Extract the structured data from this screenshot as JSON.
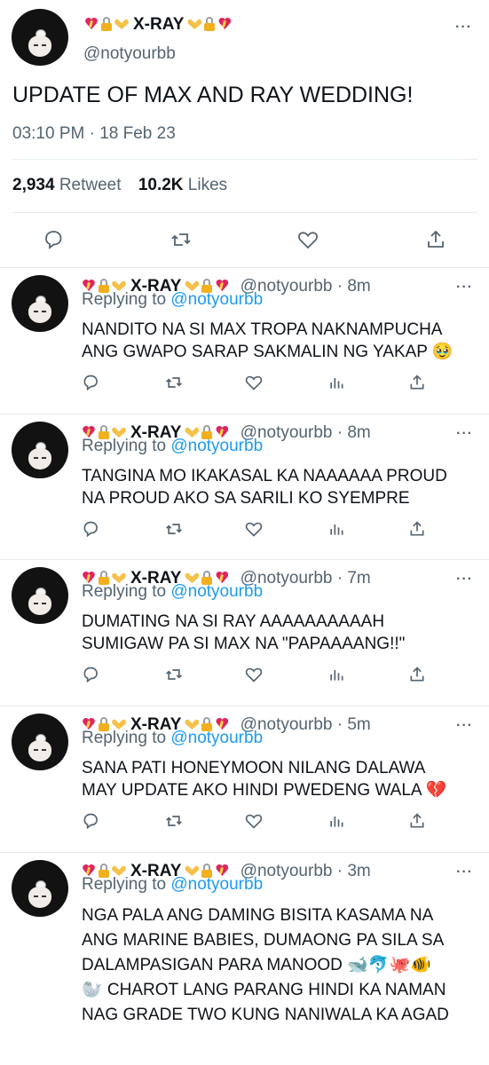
{
  "main_tweet": {
    "display_name": "X-RAY",
    "handle": "@notyourbb",
    "text": "UPDATE OF MAX AND RAY WEDDING!",
    "time": "03:10 PM",
    "separator": "·",
    "date": "18 Feb 23",
    "retweet_count": "2,934",
    "retweet_label": "Retweet",
    "like_count": "10.2K",
    "like_label": "Likes"
  },
  "replies": [
    {
      "display_name": "X-RAY",
      "handle": "@notyourbb",
      "time": "· 8m",
      "replying_label": "Replying to",
      "replying_to": "@notyourbb",
      "line1": "NANDITO NA SI MAX TROPA NAKNAMPUCHA",
      "line2": "ANG GWAPO SARAP SAKMALIN NG YAKAP 🥹"
    },
    {
      "display_name": "X-RAY",
      "handle": "@notyourbb",
      "time": "· 8m",
      "replying_label": "Replying to",
      "replying_to": "@notyourbb",
      "line1": "TANGINA MO IKAKASAL KA NAAAAAA PROUD",
      "line2": "NA PROUD AKO SA SARILI KO SYEMPRE"
    },
    {
      "display_name": "X-RAY",
      "handle": "@notyourbb",
      "time": "· 7m",
      "replying_label": "Replying to",
      "replying_to": "@notyourbb",
      "line1": "DUMATING NA SI RAY AAAAAAAAAAH",
      "line2": "SUMIGAW PA SI MAX NA \"PAPAAAANG!!\""
    },
    {
      "display_name": "X-RAY",
      "handle": "@notyourbb",
      "time": "· 5m",
      "replying_label": "Replying to",
      "replying_to": "@notyourbb",
      "line1": "SANA PATI HONEYMOON NILANG DALAWA",
      "line2": "MAY UPDATE AKO HINDI PWEDENG WALA 💔"
    },
    {
      "display_name": "X-RAY",
      "handle": "@notyourbb",
      "time": "· 3m",
      "replying_label": "Replying to",
      "replying_to": "@notyourbb",
      "line1": "NGA PALA ANG DAMING BISITA KASAMA NA",
      "line2": "ANG MARINE BABIES, DUMAONG PA SILA SA",
      "line3": "DALAMPASIGAN PARA MANOOD 🐋🐬🐙🐠",
      "line4": "🦭 CHAROT LANG PARANG HINDI KA NAMAN",
      "line5": "NAG GRADE TWO KUNG NANIWALA KA AGAD"
    }
  ],
  "icons": {
    "reply": "reply-icon",
    "retweet": "retweet-icon",
    "like": "heart-icon",
    "views": "analytics-icon",
    "share": "share-icon",
    "more": "more-icon"
  },
  "colors": {
    "text": "#0f1419",
    "secondary": "#536471",
    "link": "#1d9bf0",
    "divider": "#e6ecf0"
  }
}
